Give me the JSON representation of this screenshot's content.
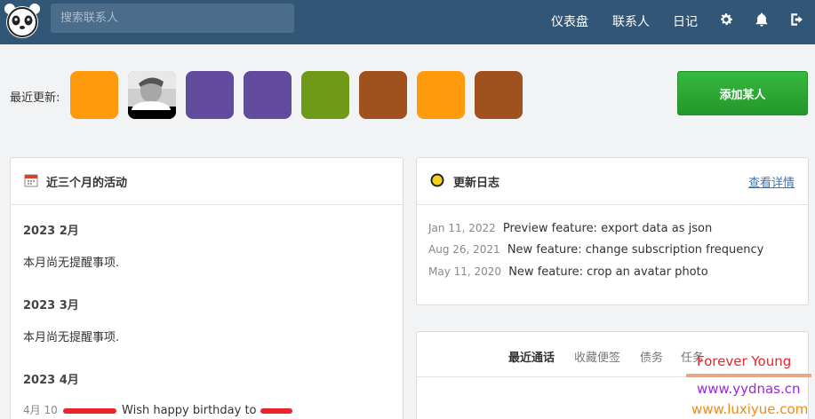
{
  "navbar": {
    "search_placeholder": "搜索联系人",
    "links": [
      "仪表盘",
      "联系人",
      "日记"
    ],
    "icons": [
      "gear-icon",
      "bell-icon",
      "logout-icon"
    ],
    "logo": "panda-logo"
  },
  "recent": {
    "label": "最近更新:",
    "avatar_colors": [
      "#ff9a0c",
      "photo",
      "#624a9c",
      "#624a9c",
      "#6e9a18",
      "#a0521e",
      "#ff9a0c",
      "#a0521e"
    ],
    "add_button": "添加某人"
  },
  "activity": {
    "title": "近三个月的活动",
    "months": [
      {
        "label": "2023 2月",
        "note": "本月尚无提醒事项."
      },
      {
        "label": "2023 3月",
        "note": "本月尚无提醒事项."
      },
      {
        "label": "2023 4月",
        "date": "4月 10",
        "note": "Wish happy birthday to"
      }
    ]
  },
  "changelog": {
    "title": "更新日志",
    "details_link": "查看详情",
    "entries": [
      {
        "date": "Jan 11, 2022",
        "text": "Preview feature: export data as json"
      },
      {
        "date": "Aug 26, 2021",
        "text": "New feature: change subscription frequency"
      },
      {
        "date": "May 11, 2020",
        "text": "New feature: crop an avatar photo"
      }
    ]
  },
  "tabs": {
    "items": [
      "最近通话",
      "收藏便签",
      "债务",
      "任务"
    ],
    "active": 0
  },
  "watermark": {
    "line1": "Forever Young",
    "line2": "www.yydnas.cn",
    "line3": "www.luxiyue.com"
  }
}
